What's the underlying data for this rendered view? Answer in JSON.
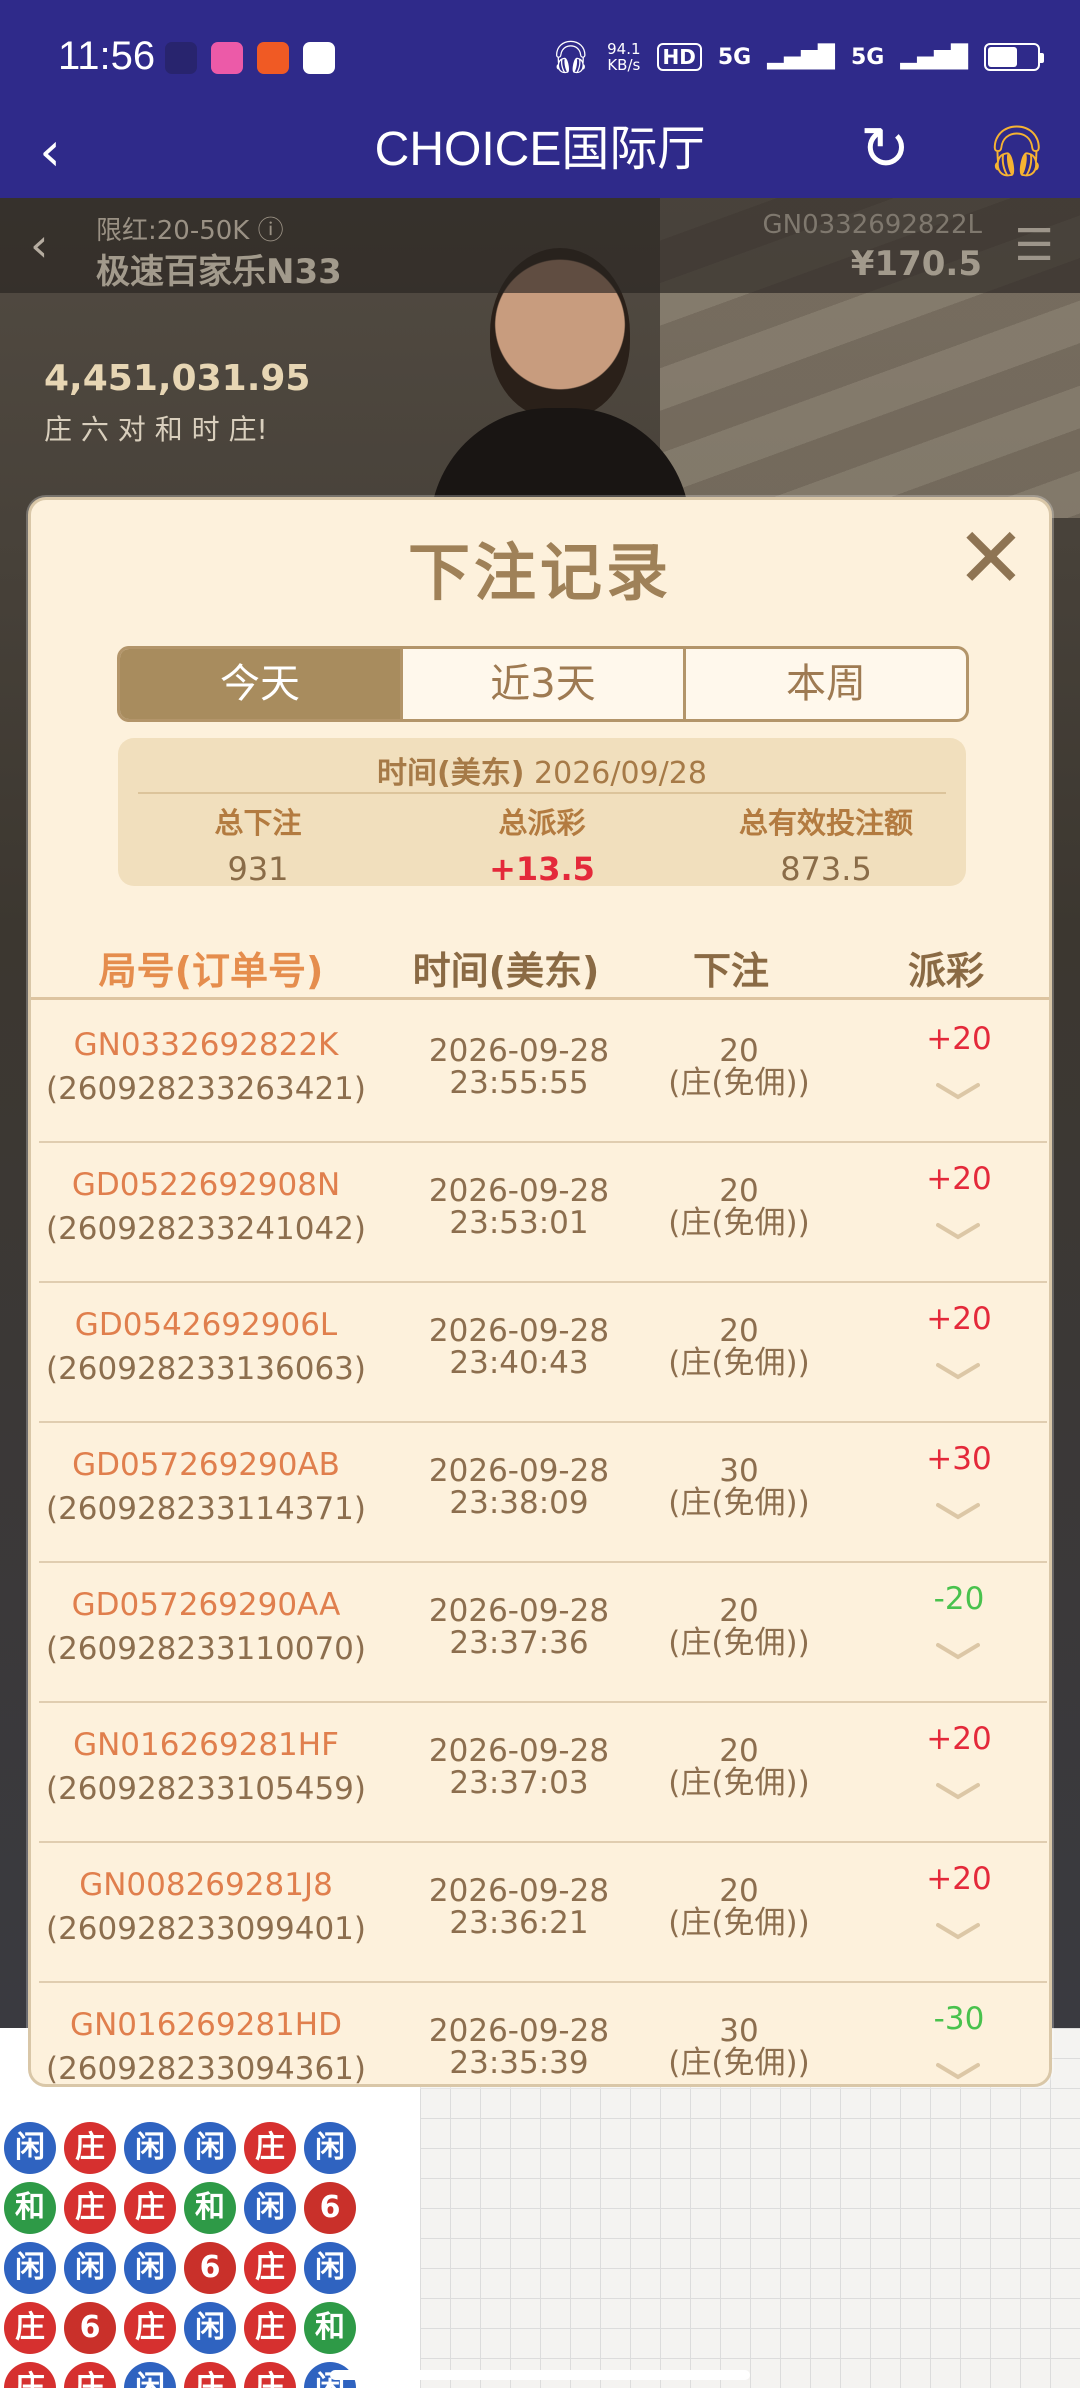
{
  "status": {
    "time": "11:56",
    "speed_top": "94.1",
    "speed_unit": "KB/s",
    "hd": "HD",
    "net1": "5G",
    "net2": "5G",
    "battery_level": 0.55
  },
  "app": {
    "title": "CHOICE国际厅"
  },
  "video": {
    "limit": "限红:20-50K ⓘ",
    "table_name": "极速百家乐N33",
    "order_no": "GN0332692822L",
    "balance": "¥170.5",
    "pool": "4,451,031.95",
    "bet_types": "庄 六 对 和 时 庄!"
  },
  "modal": {
    "title": "下注记录",
    "tabs": [
      "今天",
      "近3天",
      "本周"
    ],
    "active_tab": 0,
    "summary": {
      "time_label": "时间(美东)",
      "date": "2026/09/28",
      "total_bet_label": "总下注",
      "total_bet": "931",
      "total_payout_label": "总派彩",
      "total_payout": "+13.5",
      "effective_label": "总有效投注额",
      "effective": "873.5"
    },
    "columns": [
      "局号(订单号)",
      "时间(美东)",
      "下注",
      "派彩"
    ],
    "records": [
      {
        "round": "GN0332692822K",
        "order": "(260928233263421)",
        "date": "2026-09-28",
        "time": "23:55:55",
        "amount": "20",
        "type": "(庄(免佣))",
        "payout": "+20"
      },
      {
        "round": "GD0522692908N",
        "order": "(260928233241042)",
        "date": "2026-09-28",
        "time": "23:53:01",
        "amount": "20",
        "type": "(庄(免佣))",
        "payout": "+20"
      },
      {
        "round": "GD0542692906L",
        "order": "(260928233136063)",
        "date": "2026-09-28",
        "time": "23:40:43",
        "amount": "20",
        "type": "(庄(免佣))",
        "payout": "+20"
      },
      {
        "round": "GD057269290AB",
        "order": "(260928233114371)",
        "date": "2026-09-28",
        "time": "23:38:09",
        "amount": "30",
        "type": "(庄(免佣))",
        "payout": "+30"
      },
      {
        "round": "GD057269290AA",
        "order": "(260928233110070)",
        "date": "2026-09-28",
        "time": "23:37:36",
        "amount": "20",
        "type": "(庄(免佣))",
        "payout": "-20"
      },
      {
        "round": "GN016269281HF",
        "order": "(260928233105459)",
        "date": "2026-09-28",
        "time": "23:37:03",
        "amount": "20",
        "type": "(庄(免佣))",
        "payout": "+20"
      },
      {
        "round": "GN008269281J8",
        "order": "(260928233099401)",
        "date": "2026-09-28",
        "time": "23:36:21",
        "amount": "20",
        "type": "(庄(免佣))",
        "payout": "+20"
      },
      {
        "round": "GN016269281HD",
        "order": "(260928233094361)",
        "date": "2026-09-28",
        "time": "23:35:39",
        "amount": "30",
        "type": "(庄(免佣))",
        "payout": "-30"
      }
    ]
  },
  "road": {
    "beads": [
      [
        "闲",
        "庄",
        "闲",
        "闲",
        "庄",
        "闲"
      ],
      [
        "和",
        "庄",
        "庄",
        "和",
        "闲",
        "6"
      ],
      [
        "闲",
        "闲",
        "闲",
        "6",
        "庄",
        "闲"
      ],
      [
        "庄",
        "6",
        "庄",
        "闲",
        "庄",
        "和"
      ],
      [
        "庄",
        "庄",
        "闲",
        "庄",
        "庄",
        "闲"
      ]
    ],
    "colors": {
      "庄": "#d6302f",
      "闲": "#2f63c0",
      "和": "#2e9a47",
      "6": "#c9302a"
    }
  }
}
